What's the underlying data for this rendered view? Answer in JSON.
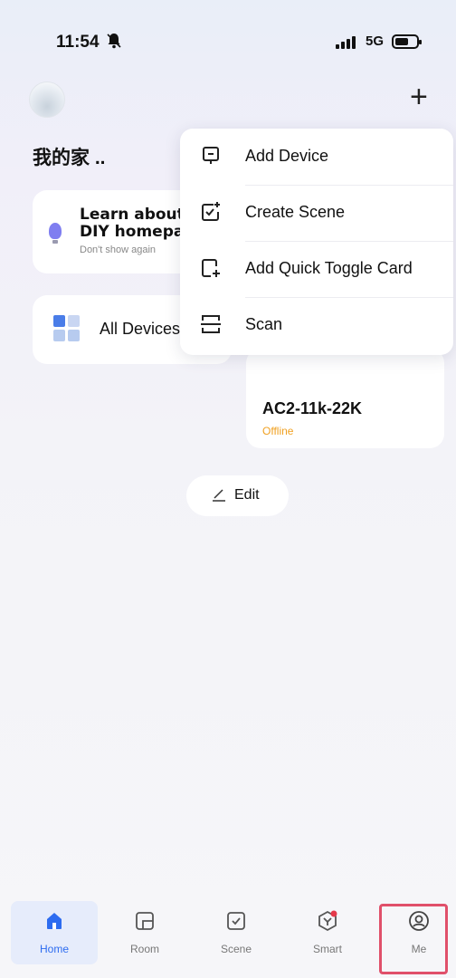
{
  "status_bar": {
    "time": "11:54",
    "network": "5G"
  },
  "header": {
    "home_name": "我的家 .."
  },
  "learn_card": {
    "title_line1": "Learn about",
    "title_line2": "DIY homepage",
    "subtitle": "Don't show again"
  },
  "all_devices": {
    "label": "All Devices"
  },
  "device": {
    "name": "AC2-11k-22K",
    "status": "Offline"
  },
  "edit": {
    "label": "Edit"
  },
  "menu": {
    "items": [
      {
        "label": "Add Device",
        "icon": "add-device-icon"
      },
      {
        "label": "Create Scene",
        "icon": "create-scene-icon"
      },
      {
        "label": "Add Quick Toggle Card",
        "icon": "quick-toggle-icon"
      },
      {
        "label": "Scan",
        "icon": "scan-icon"
      }
    ]
  },
  "tabs": [
    {
      "label": "Home",
      "icon": "home-icon",
      "active": true
    },
    {
      "label": "Room",
      "icon": "room-icon"
    },
    {
      "label": "Scene",
      "icon": "scene-icon"
    },
    {
      "label": "Smart",
      "icon": "smart-icon"
    },
    {
      "label": "Me",
      "icon": "me-icon"
    }
  ],
  "colors": {
    "accent": "#2d6cf0",
    "offline": "#f0a020",
    "highlight": "#e0506a"
  }
}
